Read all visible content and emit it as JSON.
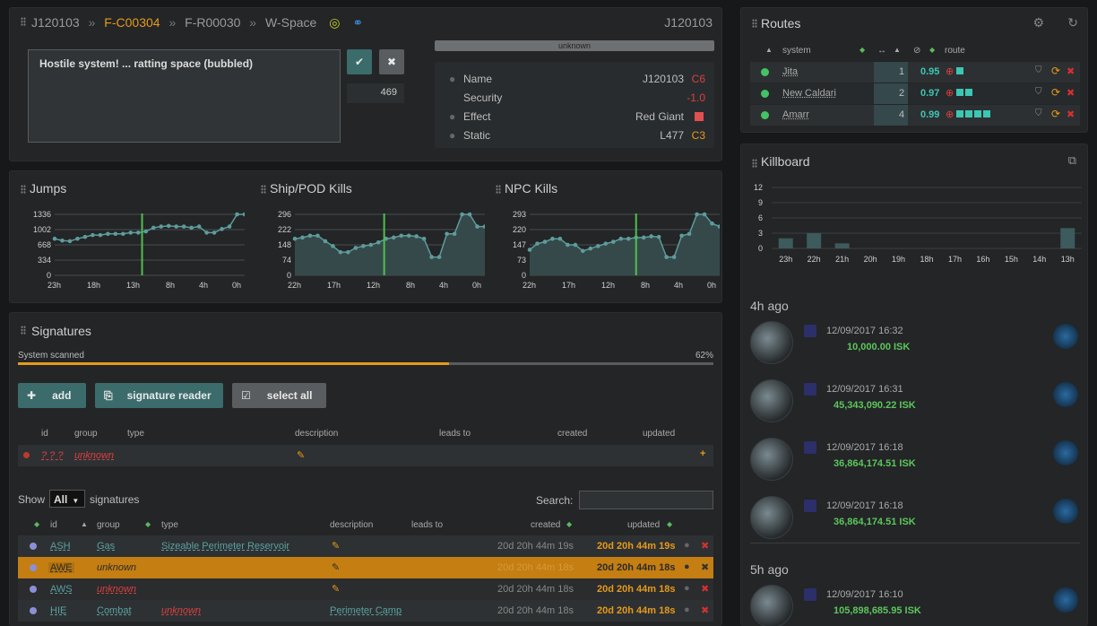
{
  "header": {
    "crumbs": [
      "J120103",
      "F-C00304",
      "F-R00030",
      "W-Space"
    ],
    "system_right": "J120103"
  },
  "notes": {
    "text": "Hostile system! ... ratting space (bubbled)",
    "counter": "469"
  },
  "info": {
    "status": "unknown",
    "rows": [
      {
        "k": "Name",
        "v": "J120103",
        "badge": "C6"
      },
      {
        "k": "Security",
        "v": "-1.0"
      },
      {
        "k": "Effect",
        "v": "Red Giant"
      },
      {
        "k": "Static",
        "v": "L477",
        "badge": "C3"
      }
    ]
  },
  "routes": {
    "title": "Routes",
    "headers": [
      "system",
      "route"
    ],
    "rows": [
      {
        "system": "Jita",
        "jumps": "1",
        "sec": "0.95"
      },
      {
        "system": "New Caldari",
        "jumps": "2",
        "sec": "0.97"
      },
      {
        "system": "Amarr",
        "jumps": "4",
        "sec": "0.99"
      }
    ]
  },
  "graphs": [
    {
      "title": "Jumps",
      "yticks": [
        "1336",
        "1002",
        "668",
        "334",
        "0"
      ],
      "xticks": [
        "23h",
        "18h",
        "13h",
        "8h",
        "4h",
        "0h"
      ]
    },
    {
      "title": "Ship/POD Kills",
      "yticks": [
        "296",
        "222",
        "148",
        "74",
        "0"
      ],
      "xticks": [
        "22h",
        "17h",
        "12h",
        "8h",
        "4h",
        "0h"
      ]
    },
    {
      "title": "NPC Kills",
      "yticks": [
        "293",
        "220",
        "147",
        "73",
        "0"
      ],
      "xticks": [
        "22h",
        "17h",
        "12h",
        "8h",
        "4h",
        "0h"
      ]
    }
  ],
  "killboard": {
    "title": "Killboard",
    "yticks": [
      "12",
      "9",
      "6",
      "3",
      "0"
    ],
    "xticks": [
      "23h",
      "22h",
      "21h",
      "20h",
      "19h",
      "18h",
      "17h",
      "16h",
      "15h",
      "14h",
      "13h"
    ],
    "groups": [
      {
        "label": "4h ago",
        "items": [
          {
            "time": "12/09/2017 16:32",
            "isk": "10,000.00 ISK"
          },
          {
            "time": "12/09/2017 16:31",
            "isk": "45,343,090.22 ISK"
          },
          {
            "time": "12/09/2017 16:18",
            "isk": "36,864,174.51 ISK"
          },
          {
            "time": "12/09/2017 16:18",
            "isk": "36,864,174.51 ISK"
          }
        ]
      },
      {
        "label": "5h ago",
        "items": [
          {
            "time": "12/09/2017 16:10",
            "isk": "105,898,685.95 ISK"
          }
        ]
      }
    ]
  },
  "signatures": {
    "title": "Signatures",
    "scan_label": "System scanned",
    "scan_pct": "62%",
    "buttons": {
      "add": "add",
      "reader": "signature reader",
      "select": "select all"
    },
    "new_headers": [
      "id",
      "group",
      "type",
      "description",
      "leads to",
      "created",
      "updated"
    ],
    "new_row": {
      "id": "? ? ?",
      "group": "unknown"
    },
    "show": "Show",
    "show_value": "All",
    "show_suffix": "signatures",
    "search": "Search:",
    "headers": [
      "id",
      "group",
      "type",
      "description",
      "leads to",
      "created",
      "updated"
    ],
    "rows": [
      {
        "id": "ASH",
        "group": "Gas",
        "type": "Sizeable Perimeter Reservoir",
        "leads": "",
        "created": "20d 20h 44m 19s",
        "updated": "20d 20h 44m 19s"
      },
      {
        "id": "AWE",
        "group": "unknown",
        "type": "",
        "leads": "",
        "created": "20d 20h 44m 18s",
        "updated": "20d 20h 44m 18s"
      },
      {
        "id": "AWS",
        "group": "unknown",
        "type": "",
        "leads": "",
        "created": "20d 20h 44m 18s",
        "updated": "20d 20h 44m 18s"
      },
      {
        "id": "HIE",
        "group": "Combat",
        "type": "unknown",
        "leads": "Perimeter Camp",
        "created": "20d 20h 44m 18s",
        "updated": "20d 20h 44m 18s"
      }
    ]
  }
}
